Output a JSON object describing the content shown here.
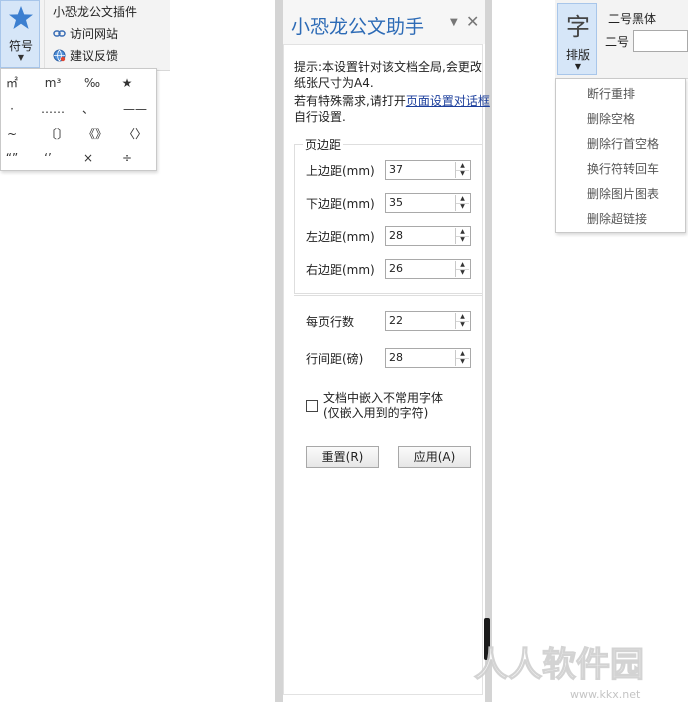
{
  "left_ribbon": {
    "symbol_button_label": "符号",
    "plugin_title": "小恐龙公文插件",
    "visit_site": "访问网站",
    "feedback": "建议反馈"
  },
  "symbol_popup": {
    "symbols": [
      "㎡",
      "m³",
      "‰",
      "★",
      "·",
      "……",
      "、",
      "——",
      "~",
      "〔〕",
      "《》",
      "〈〉",
      "“”",
      "‘’",
      "×",
      "÷"
    ]
  },
  "pane": {
    "title": "小恐龙公文助手",
    "menu_icon": "▼",
    "close_icon": "✕",
    "note1": "提示:本设置针对该文档全局,会更改纸张尺寸为A4.",
    "note2_pre": "若有特殊需求,请打开",
    "note2_link": "页面设置对话框",
    "note2_post": "自行设置.",
    "margin_legend": "页边距",
    "fields": {
      "top_label": "上边距(mm)",
      "top_value": "37",
      "bottom_label": "下边距(mm)",
      "bottom_value": "35",
      "left_label": "左边距(mm)",
      "left_value": "28",
      "right_label": "右边距(mm)",
      "right_value": "26",
      "lines_label": "每页行数",
      "lines_value": "22",
      "spacing_label": "行间距(磅)",
      "spacing_value": "28"
    },
    "embed_label_1": "文档中嵌入不常用字体",
    "embed_label_2": "(仅嵌入用到的字符)",
    "embed_checked": false,
    "reset_button": "重置(R)",
    "apply_button": "应用(A)"
  },
  "right_ribbon": {
    "layout_glyph": "字",
    "layout_label": "排版",
    "font_name": "二号黑体",
    "size_label": "二号"
  },
  "layout_menu": {
    "items": [
      "断行重排",
      "删除空格",
      "删除行首空格",
      "换行符转回车",
      "删除图片图表",
      "删除超链接"
    ]
  },
  "watermark": {
    "text": "人人软件园",
    "url": "www.kkx.net"
  },
  "colors": {
    "title_blue": "#2d6bb6",
    "button_highlight": "#d6e6f8",
    "link": "#1c3f9c"
  }
}
